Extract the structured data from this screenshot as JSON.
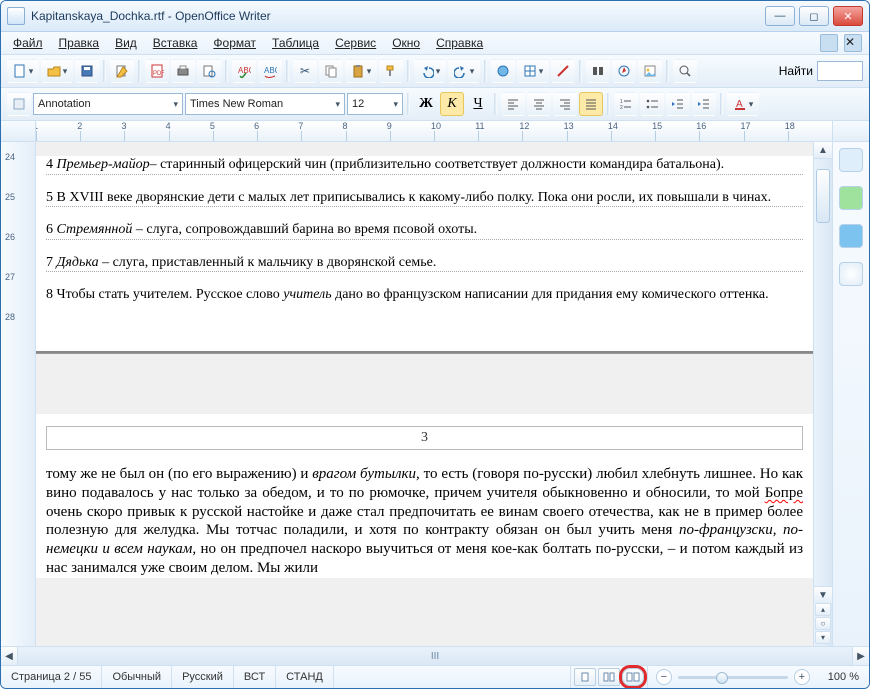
{
  "window": {
    "title": "Kapitanskaya_Dochka.rtf - OpenOffice Writer"
  },
  "menu": {
    "file": "Файл",
    "edit": "Правка",
    "view": "Вид",
    "insert": "Вставка",
    "format": "Формат",
    "table": "Таблица",
    "tools": "Сервис",
    "window": "Окно",
    "help": "Справка"
  },
  "toolbar1": {
    "find_label": "Найти"
  },
  "toolbar2": {
    "style": "Annotation",
    "font": "Times New Roman",
    "size": "12",
    "bold_char": "Ж",
    "italic_char": "К",
    "underline_char": "Ч"
  },
  "hruler": {
    "labels": [
      "1",
      "2",
      "3",
      "4",
      "5",
      "6",
      "7",
      "8",
      "9",
      "10",
      "11",
      "12",
      "13",
      "14",
      "15",
      "16",
      "17",
      "18"
    ]
  },
  "vruler": {
    "labels": [
      "24",
      "25",
      "26",
      "27",
      "28"
    ]
  },
  "doc": {
    "note4_a": "4 ",
    "note4_i": "Премьер-майор",
    "note4_b": "– старинный офицерский чин (приблизительно соответствует должности командира батальона).",
    "note5": "5 В XVIII веке дворянские дети с малых лет приписывались к какому-либо полку. Пока они росли, их повышали в чинах.",
    "note6_a": "6 ",
    "note6_i": "Стремянной",
    "note6_b": " – слуга, сопровождавший барина во время псовой охоты.",
    "note7_a": "7 ",
    "note7_i": "Дядька",
    "note7_b": " – слуга, приставленный к мальчику в дворянской семье.",
    "note8_a": "8 Чтобы стать учителем. Русское слово ",
    "note8_i": "учитель",
    "note8_b": " дано во французском написании для придания ему комического оттенка.",
    "page_number_label": "3",
    "body1_a": "тому же не был он (по его выражению) и ",
    "body1_i": "врагом бутылки,",
    "body1_b": " то есть (говоря по-русски) любил хлебнуть лишнее. Но как вино подавалось у нас только за обедом, и то по рюмочке, причем учителя обыкновенно и обносили, то мой ",
    "body1_wavy": "Бопре",
    "body1_c": " очень скоро привык к русской настойке и даже стал предпочитать ее винам своего отечества, как не в пример более полезную для желудка. Мы тотчас поладили, и хотя по контракту обязан он был учить меня ",
    "body1_i2": "по-французски, по-немецки и всем наукам,",
    "body1_d": " но он предпочел наскоро выучиться от меня кое-как болтать по-русски, – и потом каждый из нас занимался уже своим делом. Мы жили"
  },
  "status": {
    "page": "Страница 2 / 55",
    "style": "Обычный",
    "lang": "Русский",
    "mode1": "ВСТ",
    "mode2": "СТАНД",
    "zoom": "100 %"
  },
  "hscroll_mid": "III"
}
